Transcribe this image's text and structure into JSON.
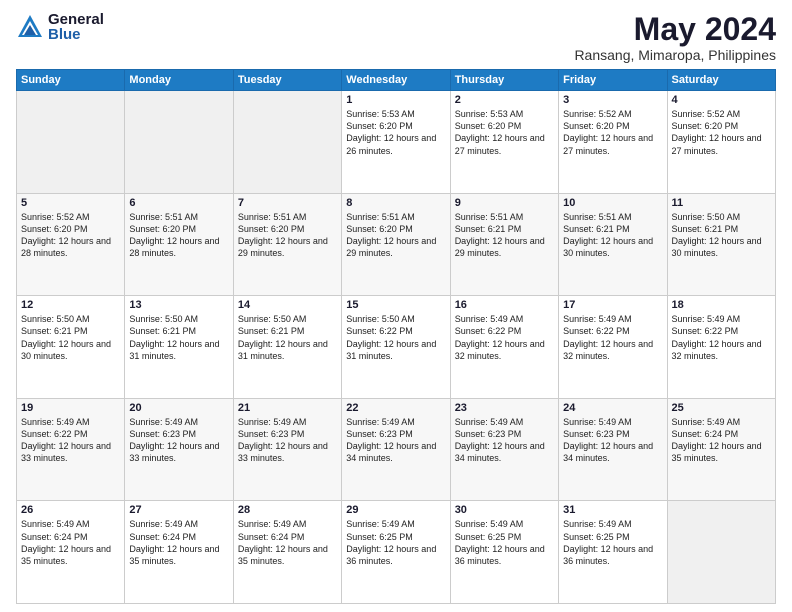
{
  "logo": {
    "general": "General",
    "blue": "Blue"
  },
  "title": {
    "month_year": "May 2024",
    "location": "Ransang, Mimaropa, Philippines"
  },
  "days_of_week": [
    "Sunday",
    "Monday",
    "Tuesday",
    "Wednesday",
    "Thursday",
    "Friday",
    "Saturday"
  ],
  "weeks": [
    [
      {
        "day": "",
        "sunrise": "",
        "sunset": "",
        "daylight": ""
      },
      {
        "day": "",
        "sunrise": "",
        "sunset": "",
        "daylight": ""
      },
      {
        "day": "",
        "sunrise": "",
        "sunset": "",
        "daylight": ""
      },
      {
        "day": "1",
        "sunrise": "Sunrise: 5:53 AM",
        "sunset": "Sunset: 6:20 PM",
        "daylight": "Daylight: 12 hours and 26 minutes."
      },
      {
        "day": "2",
        "sunrise": "Sunrise: 5:53 AM",
        "sunset": "Sunset: 6:20 PM",
        "daylight": "Daylight: 12 hours and 27 minutes."
      },
      {
        "day": "3",
        "sunrise": "Sunrise: 5:52 AM",
        "sunset": "Sunset: 6:20 PM",
        "daylight": "Daylight: 12 hours and 27 minutes."
      },
      {
        "day": "4",
        "sunrise": "Sunrise: 5:52 AM",
        "sunset": "Sunset: 6:20 PM",
        "daylight": "Daylight: 12 hours and 27 minutes."
      }
    ],
    [
      {
        "day": "5",
        "sunrise": "Sunrise: 5:52 AM",
        "sunset": "Sunset: 6:20 PM",
        "daylight": "Daylight: 12 hours and 28 minutes."
      },
      {
        "day": "6",
        "sunrise": "Sunrise: 5:51 AM",
        "sunset": "Sunset: 6:20 PM",
        "daylight": "Daylight: 12 hours and 28 minutes."
      },
      {
        "day": "7",
        "sunrise": "Sunrise: 5:51 AM",
        "sunset": "Sunset: 6:20 PM",
        "daylight": "Daylight: 12 hours and 29 minutes."
      },
      {
        "day": "8",
        "sunrise": "Sunrise: 5:51 AM",
        "sunset": "Sunset: 6:20 PM",
        "daylight": "Daylight: 12 hours and 29 minutes."
      },
      {
        "day": "9",
        "sunrise": "Sunrise: 5:51 AM",
        "sunset": "Sunset: 6:21 PM",
        "daylight": "Daylight: 12 hours and 29 minutes."
      },
      {
        "day": "10",
        "sunrise": "Sunrise: 5:51 AM",
        "sunset": "Sunset: 6:21 PM",
        "daylight": "Daylight: 12 hours and 30 minutes."
      },
      {
        "day": "11",
        "sunrise": "Sunrise: 5:50 AM",
        "sunset": "Sunset: 6:21 PM",
        "daylight": "Daylight: 12 hours and 30 minutes."
      }
    ],
    [
      {
        "day": "12",
        "sunrise": "Sunrise: 5:50 AM",
        "sunset": "Sunset: 6:21 PM",
        "daylight": "Daylight: 12 hours and 30 minutes."
      },
      {
        "day": "13",
        "sunrise": "Sunrise: 5:50 AM",
        "sunset": "Sunset: 6:21 PM",
        "daylight": "Daylight: 12 hours and 31 minutes."
      },
      {
        "day": "14",
        "sunrise": "Sunrise: 5:50 AM",
        "sunset": "Sunset: 6:21 PM",
        "daylight": "Daylight: 12 hours and 31 minutes."
      },
      {
        "day": "15",
        "sunrise": "Sunrise: 5:50 AM",
        "sunset": "Sunset: 6:22 PM",
        "daylight": "Daylight: 12 hours and 31 minutes."
      },
      {
        "day": "16",
        "sunrise": "Sunrise: 5:49 AM",
        "sunset": "Sunset: 6:22 PM",
        "daylight": "Daylight: 12 hours and 32 minutes."
      },
      {
        "day": "17",
        "sunrise": "Sunrise: 5:49 AM",
        "sunset": "Sunset: 6:22 PM",
        "daylight": "Daylight: 12 hours and 32 minutes."
      },
      {
        "day": "18",
        "sunrise": "Sunrise: 5:49 AM",
        "sunset": "Sunset: 6:22 PM",
        "daylight": "Daylight: 12 hours and 32 minutes."
      }
    ],
    [
      {
        "day": "19",
        "sunrise": "Sunrise: 5:49 AM",
        "sunset": "Sunset: 6:22 PM",
        "daylight": "Daylight: 12 hours and 33 minutes."
      },
      {
        "day": "20",
        "sunrise": "Sunrise: 5:49 AM",
        "sunset": "Sunset: 6:23 PM",
        "daylight": "Daylight: 12 hours and 33 minutes."
      },
      {
        "day": "21",
        "sunrise": "Sunrise: 5:49 AM",
        "sunset": "Sunset: 6:23 PM",
        "daylight": "Daylight: 12 hours and 33 minutes."
      },
      {
        "day": "22",
        "sunrise": "Sunrise: 5:49 AM",
        "sunset": "Sunset: 6:23 PM",
        "daylight": "Daylight: 12 hours and 34 minutes."
      },
      {
        "day": "23",
        "sunrise": "Sunrise: 5:49 AM",
        "sunset": "Sunset: 6:23 PM",
        "daylight": "Daylight: 12 hours and 34 minutes."
      },
      {
        "day": "24",
        "sunrise": "Sunrise: 5:49 AM",
        "sunset": "Sunset: 6:23 PM",
        "daylight": "Daylight: 12 hours and 34 minutes."
      },
      {
        "day": "25",
        "sunrise": "Sunrise: 5:49 AM",
        "sunset": "Sunset: 6:24 PM",
        "daylight": "Daylight: 12 hours and 35 minutes."
      }
    ],
    [
      {
        "day": "26",
        "sunrise": "Sunrise: 5:49 AM",
        "sunset": "Sunset: 6:24 PM",
        "daylight": "Daylight: 12 hours and 35 minutes."
      },
      {
        "day": "27",
        "sunrise": "Sunrise: 5:49 AM",
        "sunset": "Sunset: 6:24 PM",
        "daylight": "Daylight: 12 hours and 35 minutes."
      },
      {
        "day": "28",
        "sunrise": "Sunrise: 5:49 AM",
        "sunset": "Sunset: 6:24 PM",
        "daylight": "Daylight: 12 hours and 35 minutes."
      },
      {
        "day": "29",
        "sunrise": "Sunrise: 5:49 AM",
        "sunset": "Sunset: 6:25 PM",
        "daylight": "Daylight: 12 hours and 36 minutes."
      },
      {
        "day": "30",
        "sunrise": "Sunrise: 5:49 AM",
        "sunset": "Sunset: 6:25 PM",
        "daylight": "Daylight: 12 hours and 36 minutes."
      },
      {
        "day": "31",
        "sunrise": "Sunrise: 5:49 AM",
        "sunset": "Sunset: 6:25 PM",
        "daylight": "Daylight: 12 hours and 36 minutes."
      },
      {
        "day": "",
        "sunrise": "",
        "sunset": "",
        "daylight": ""
      }
    ]
  ]
}
